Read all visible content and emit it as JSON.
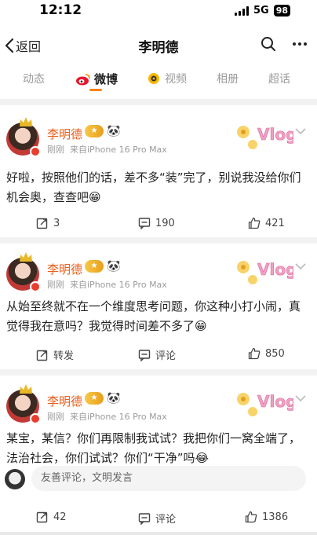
{
  "status_bar": {
    "time": "12:12",
    "network": "5G",
    "battery": "98"
  },
  "nav": {
    "back_label": "返回",
    "title": "李明德"
  },
  "tabs": [
    {
      "label": "动态"
    },
    {
      "label": "微博"
    },
    {
      "label": "视频"
    },
    {
      "label": "相册"
    },
    {
      "label": "超话"
    }
  ],
  "posts": [
    {
      "author": "李明德",
      "time": "刚刚",
      "source": "来自iPhone 16 Pro Max",
      "text": "好啦，按照他们的话，差不多“装”完了，别说我没给你们机会奥，查查吧😁",
      "reposts": "3",
      "comments": "190",
      "likes": "421"
    },
    {
      "author": "李明德",
      "time": "刚刚",
      "source": "来自iPhone 16 Pro Max",
      "text": "从始至终就不在一个维度思考问题，你这种小打小闹，真觉得我在意吗？我觉得时间差不多了😁",
      "reposts": "转发",
      "comments": "评论",
      "likes": "850"
    },
    {
      "author": "李明德",
      "time": "刚刚",
      "source": "来自iPhone 16 Pro Max",
      "text": "某宝，某信？你们再限制我试试？我把你们一窝全端了，法治社会，你们试试？你们“干净”吗😂",
      "reposts": "42",
      "comments": "评论",
      "likes": "1386"
    }
  ],
  "comment_input": {
    "placeholder": "友善评论，文明发言"
  },
  "colors": {
    "accent": "#ff8200",
    "username": "#ea5d1a",
    "muted": "#9b9b9b"
  }
}
